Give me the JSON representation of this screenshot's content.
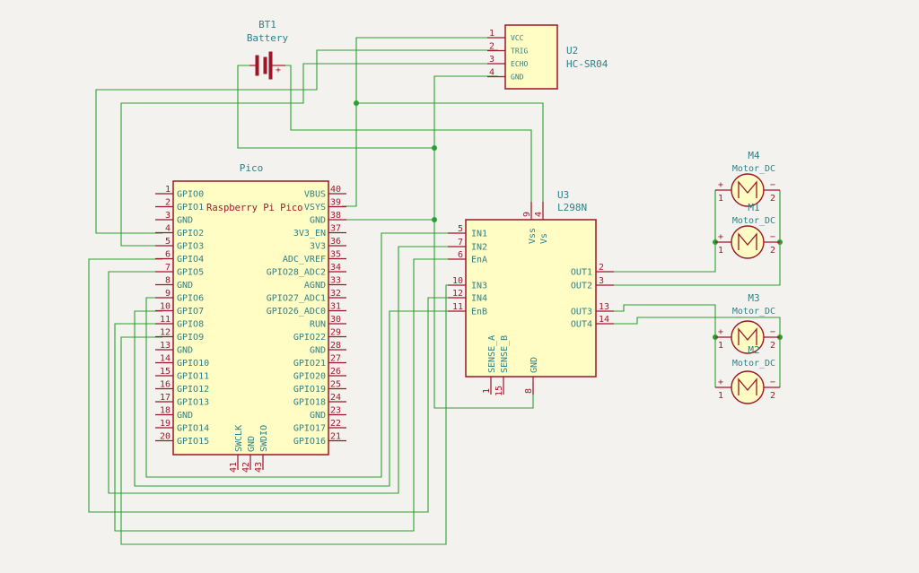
{
  "battery": {
    "ref": "BT1",
    "value": "Battery",
    "plus": "+"
  },
  "sensor": {
    "ref": "U2",
    "value": "HC-SR04",
    "pins": [
      {
        "num": "1",
        "name": "VCC"
      },
      {
        "num": "2",
        "name": "TRIG"
      },
      {
        "num": "3",
        "name": "ECHO"
      },
      {
        "num": "4",
        "name": "GND"
      }
    ]
  },
  "pico": {
    "ref": "Pico",
    "title": "Raspberry Pi Pico",
    "left_pins": [
      {
        "num": "1",
        "name": "GPIO0"
      },
      {
        "num": "2",
        "name": "GPIO1"
      },
      {
        "num": "3",
        "name": "GND"
      },
      {
        "num": "4",
        "name": "GPIO2"
      },
      {
        "num": "5",
        "name": "GPIO3"
      },
      {
        "num": "6",
        "name": "GPIO4"
      },
      {
        "num": "7",
        "name": "GPIO5"
      },
      {
        "num": "8",
        "name": "GND"
      },
      {
        "num": "9",
        "name": "GPIO6"
      },
      {
        "num": "10",
        "name": "GPIO7"
      },
      {
        "num": "11",
        "name": "GPIO8"
      },
      {
        "num": "12",
        "name": "GPIO9"
      },
      {
        "num": "13",
        "name": "GND"
      },
      {
        "num": "14",
        "name": "GPIO10"
      },
      {
        "num": "15",
        "name": "GPIO11"
      },
      {
        "num": "16",
        "name": "GPIO12"
      },
      {
        "num": "17",
        "name": "GPIO13"
      },
      {
        "num": "18",
        "name": "GND"
      },
      {
        "num": "19",
        "name": "GPIO14"
      },
      {
        "num": "20",
        "name": "GPIO15"
      }
    ],
    "right_pins": [
      {
        "num": "40",
        "name": "VBUS"
      },
      {
        "num": "39",
        "name": "VSYS"
      },
      {
        "num": "38",
        "name": "GND"
      },
      {
        "num": "37",
        "name": "3V3_EN"
      },
      {
        "num": "36",
        "name": "3V3"
      },
      {
        "num": "35",
        "name": "ADC_VREF"
      },
      {
        "num": "34",
        "name": "GPIO28_ADC2"
      },
      {
        "num": "33",
        "name": "AGND"
      },
      {
        "num": "32",
        "name": "GPIO27_ADC1"
      },
      {
        "num": "31",
        "name": "GPIO26_ADC0"
      },
      {
        "num": "30",
        "name": "RUN"
      },
      {
        "num": "29",
        "name": "GPIO22"
      },
      {
        "num": "28",
        "name": "GND"
      },
      {
        "num": "27",
        "name": "GPIO21"
      },
      {
        "num": "26",
        "name": "GPIO20"
      },
      {
        "num": "25",
        "name": "GPIO19"
      },
      {
        "num": "24",
        "name": "GPIO18"
      },
      {
        "num": "23",
        "name": "GND"
      },
      {
        "num": "22",
        "name": "GPIO17"
      },
      {
        "num": "21",
        "name": "GPIO16"
      }
    ],
    "bottom_pins": [
      {
        "num": "41",
        "name": "SWCLK"
      },
      {
        "num": "42",
        "name": "GND"
      },
      {
        "num": "43",
        "name": "SWDIO"
      }
    ]
  },
  "driver": {
    "ref": "U3",
    "value": "L298N",
    "left_pins": [
      {
        "num": "5",
        "name": "IN1"
      },
      {
        "num": "7",
        "name": "IN2"
      },
      {
        "num": "6",
        "name": "EnA"
      },
      {
        "num": "10",
        "name": "IN3"
      },
      {
        "num": "12",
        "name": "IN4"
      },
      {
        "num": "11",
        "name": "EnB"
      }
    ],
    "right_pins": [
      {
        "num": "2",
        "name": "OUT1"
      },
      {
        "num": "3",
        "name": "OUT2"
      },
      {
        "num": "13",
        "name": "OUT3"
      },
      {
        "num": "14",
        "name": "OUT4"
      }
    ],
    "top_pins": [
      {
        "num": "9",
        "name": "Vss"
      },
      {
        "num": "4",
        "name": "Vs"
      }
    ],
    "bottom_pins": [
      {
        "num": "1",
        "name": "SENSE_A"
      },
      {
        "num": "15",
        "name": "SENSE_B"
      },
      {
        "num": "8",
        "name": "GND"
      }
    ]
  },
  "motors": [
    {
      "ref": "M4",
      "value": "Motor_DC",
      "plus": "+",
      "minus": "−",
      "pin1": "1",
      "pin2": "2"
    },
    {
      "ref": "M1",
      "value": "Motor_DC",
      "plus": "+",
      "minus": "−",
      "pin1": "1",
      "pin2": "2"
    },
    {
      "ref": "M3",
      "value": "Motor_DC",
      "plus": "+",
      "minus": "−",
      "pin1": "1",
      "pin2": "2"
    },
    {
      "ref": "M2",
      "value": "Motor_DC",
      "plus": "+",
      "minus": "−",
      "pin1": "1",
      "pin2": "2"
    }
  ]
}
